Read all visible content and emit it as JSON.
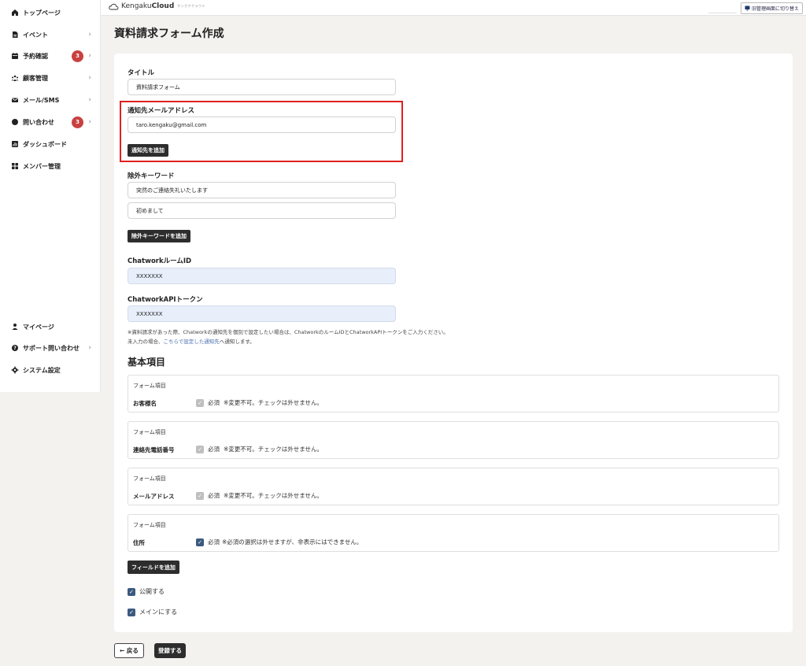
{
  "sidebar": {
    "items": [
      {
        "label": "トップページ",
        "icon": "home-icon"
      },
      {
        "label": "イベント",
        "icon": "document-icon"
      },
      {
        "label": "予約確認",
        "icon": "calendar-icon",
        "badge": "3"
      },
      {
        "label": "顧客管理",
        "icon": "users-icon"
      },
      {
        "label": "メール/SMS",
        "icon": "mail-icon"
      },
      {
        "label": "問い合わせ",
        "icon": "chat-icon",
        "badge": "3"
      },
      {
        "label": "ダッシュボード",
        "icon": "chart-icon"
      },
      {
        "label": "メンバー管理",
        "icon": "grid-icon"
      }
    ],
    "bottom_items": [
      {
        "label": "マイページ",
        "icon": "person-icon"
      },
      {
        "label": "サポート問い合わせ",
        "icon": "help-icon"
      },
      {
        "label": "システム設定",
        "icon": "gear-icon"
      }
    ]
  },
  "header": {
    "logo_light": "Kengaku",
    "logo_bold": "Cloud",
    "logo_tag": "ケンガククラウド",
    "switch_label": "旧管理画面に切り替え"
  },
  "page": {
    "title": "資料請求フォーム作成"
  },
  "form": {
    "title_label": "タイトル",
    "title_value": "資料請求フォーム",
    "notify_label": "通知先メールアドレス",
    "notify_value": "taro.kengaku@gmail.com",
    "add_notify": "通知先を追加",
    "exclude_label": "除外キーワード",
    "exclude_values": [
      "突然のご連絡失礼いたします",
      "初めまして"
    ],
    "add_exclude": "除外キーワードを追加",
    "room_label": "ChatworkルームID",
    "room_value": "XXXXXXX",
    "token_label": "ChatworkAPIトークン",
    "token_value": "XXXXXXX",
    "note_line1": "※資料請求があった際、Chatworkの通知先を個別で設定したい場合は、ChatworkのルームIDとChatworkAPIトークンをご入力ください。",
    "note_line2_pre": "未入力の場合、",
    "note_line2_link": "こちらで設定した通知先",
    "note_line2_post": "へ通知します。",
    "basic_title": "基本項目",
    "fields": [
      {
        "head": "フォーム項目",
        "name": "お客様名",
        "required": "必須",
        "note": "※変更不可。チェックは外せません。",
        "editable": false
      },
      {
        "head": "フォーム項目",
        "name": "連絡先電話番号",
        "required": "必須",
        "note": "※変更不可。チェックは外せません。",
        "editable": false
      },
      {
        "head": "フォーム項目",
        "name": "メールアドレス",
        "required": "必須",
        "note": "※変更不可。チェックは外せません。",
        "editable": false
      },
      {
        "head": "フォーム項目",
        "name": "住所",
        "required": "必須",
        "note": "※必須の選択は外せますが、非表示にはできません。",
        "editable": true
      }
    ],
    "add_field": "フィールドを追加",
    "publish_label": "公開する",
    "main_label": "メインにする",
    "back_label": "← 戻る",
    "submit_label": "登録する"
  },
  "colors": {
    "accent": "#2d2d2d",
    "badge": "#c94040",
    "highlight": "#e0201f",
    "checkbox": "#3b5a80"
  }
}
